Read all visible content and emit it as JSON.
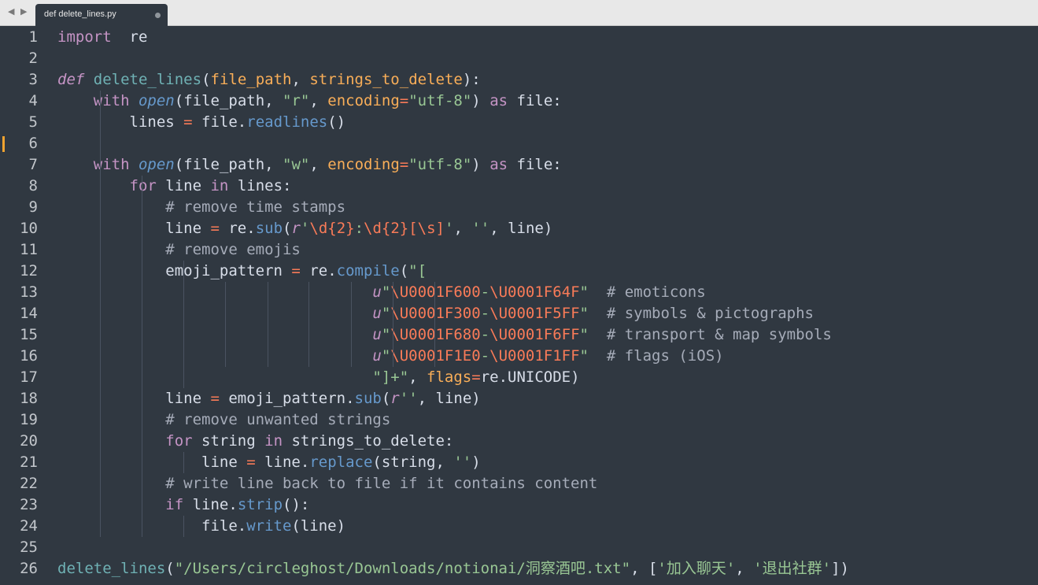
{
  "tab": {
    "title": "def delete_lines.py",
    "arrows": "◀ ▶"
  },
  "editor": {
    "lines": [
      {
        "n": "1"
      },
      {
        "n": "2"
      },
      {
        "n": "3"
      },
      {
        "n": "4"
      },
      {
        "n": "5"
      },
      {
        "n": "6"
      },
      {
        "n": "7"
      },
      {
        "n": "8"
      },
      {
        "n": "9"
      },
      {
        "n": "10"
      },
      {
        "n": "11"
      },
      {
        "n": "12"
      },
      {
        "n": "13"
      },
      {
        "n": "14"
      },
      {
        "n": "15"
      },
      {
        "n": "16"
      },
      {
        "n": "17"
      },
      {
        "n": "18"
      },
      {
        "n": "19"
      },
      {
        "n": "20"
      },
      {
        "n": "21"
      },
      {
        "n": "22"
      },
      {
        "n": "23"
      },
      {
        "n": "24"
      },
      {
        "n": "25"
      },
      {
        "n": "26"
      }
    ],
    "code": [
      [
        [
          "kw",
          "import"
        ],
        [
          "",
          "  re"
        ]
      ],
      [],
      [
        [
          "def",
          "def"
        ],
        [
          "",
          " "
        ],
        [
          "fn",
          "delete_lines"
        ],
        [
          "",
          "("
        ],
        [
          "param",
          "file_path"
        ],
        [
          "",
          ", "
        ],
        [
          "param",
          "strings_to_delete"
        ],
        [
          "",
          "):"
        ]
      ],
      [
        [
          "",
          "    "
        ],
        [
          "kw",
          "with"
        ],
        [
          "",
          " "
        ],
        [
          "bi",
          "open"
        ],
        [
          "",
          "(file_path, "
        ],
        [
          "str",
          "\"r\""
        ],
        [
          "",
          ", "
        ],
        [
          "param",
          "encoding"
        ],
        [
          "op",
          "="
        ],
        [
          "str",
          "\"utf-8\""
        ],
        [
          "",
          ") "
        ],
        [
          "kw",
          "as"
        ],
        [
          "",
          " file:"
        ]
      ],
      [
        [
          "",
          "        lines "
        ],
        [
          "op",
          "="
        ],
        [
          "",
          " file."
        ],
        [
          "meth",
          "readlines"
        ],
        [
          "",
          "()"
        ]
      ],
      [],
      [
        [
          "",
          "    "
        ],
        [
          "kw",
          "with"
        ],
        [
          "",
          " "
        ],
        [
          "bi",
          "open"
        ],
        [
          "",
          "(file_path, "
        ],
        [
          "str",
          "\"w\""
        ],
        [
          "",
          ", "
        ],
        [
          "param",
          "encoding"
        ],
        [
          "op",
          "="
        ],
        [
          "str",
          "\"utf-8\""
        ],
        [
          "",
          ") "
        ],
        [
          "kw",
          "as"
        ],
        [
          "",
          " file:"
        ]
      ],
      [
        [
          "",
          "        "
        ],
        [
          "kw",
          "for"
        ],
        [
          "",
          " line "
        ],
        [
          "kw",
          "in"
        ],
        [
          "",
          " lines:"
        ]
      ],
      [
        [
          "",
          "            "
        ],
        [
          "cm",
          "# remove time stamps"
        ]
      ],
      [
        [
          "",
          "            line "
        ],
        [
          "op",
          "="
        ],
        [
          "",
          " re."
        ],
        [
          "meth",
          "sub"
        ],
        [
          "",
          "("
        ],
        [
          "pfx",
          "r"
        ],
        [
          "str",
          "'"
        ],
        [
          "esc",
          "\\d{2}"
        ],
        [
          "str",
          ":"
        ],
        [
          "esc",
          "\\d{2}[\\s]"
        ],
        [
          "str",
          "'"
        ],
        [
          "",
          ", "
        ],
        [
          "str",
          "''"
        ],
        [
          "",
          ", line)"
        ]
      ],
      [
        [
          "",
          "            "
        ],
        [
          "cm",
          "# remove emojis"
        ]
      ],
      [
        [
          "",
          "            emoji_pattern "
        ],
        [
          "op",
          "="
        ],
        [
          "",
          " re."
        ],
        [
          "meth",
          "compile"
        ],
        [
          "",
          "("
        ],
        [
          "str",
          "\"["
        ]
      ],
      [
        [
          "",
          "                                   "
        ],
        [
          "pfx",
          "u"
        ],
        [
          "str",
          "\""
        ],
        [
          "esc",
          "\\U0001F600"
        ],
        [
          "str",
          "-"
        ],
        [
          "esc",
          "\\U0001F64F"
        ],
        [
          "str",
          "\""
        ],
        [
          "",
          "  "
        ],
        [
          "cm",
          "# emoticons"
        ]
      ],
      [
        [
          "",
          "                                   "
        ],
        [
          "pfx",
          "u"
        ],
        [
          "str",
          "\""
        ],
        [
          "esc",
          "\\U0001F300"
        ],
        [
          "str",
          "-"
        ],
        [
          "esc",
          "\\U0001F5FF"
        ],
        [
          "str",
          "\""
        ],
        [
          "",
          "  "
        ],
        [
          "cm",
          "# symbols & pictographs"
        ]
      ],
      [
        [
          "",
          "                                   "
        ],
        [
          "pfx",
          "u"
        ],
        [
          "str",
          "\""
        ],
        [
          "esc",
          "\\U0001F680"
        ],
        [
          "str",
          "-"
        ],
        [
          "esc",
          "\\U0001F6FF"
        ],
        [
          "str",
          "\""
        ],
        [
          "",
          "  "
        ],
        [
          "cm",
          "# transport & map symbols"
        ]
      ],
      [
        [
          "",
          "                                   "
        ],
        [
          "pfx",
          "u"
        ],
        [
          "str",
          "\""
        ],
        [
          "esc",
          "\\U0001F1E0"
        ],
        [
          "str",
          "-"
        ],
        [
          "esc",
          "\\U0001F1FF"
        ],
        [
          "str",
          "\""
        ],
        [
          "",
          "  "
        ],
        [
          "cm",
          "# flags (iOS)"
        ]
      ],
      [
        [
          "",
          "                                   "
        ],
        [
          "str",
          "\"]+\""
        ],
        [
          "",
          ", "
        ],
        [
          "param",
          "flags"
        ],
        [
          "op",
          "="
        ],
        [
          "",
          "re.UNICODE)"
        ]
      ],
      [
        [
          "",
          "            line "
        ],
        [
          "op",
          "="
        ],
        [
          "",
          " emoji_pattern."
        ],
        [
          "meth",
          "sub"
        ],
        [
          "",
          "("
        ],
        [
          "pfx",
          "r"
        ],
        [
          "str",
          "''"
        ],
        [
          "",
          ", line)"
        ]
      ],
      [
        [
          "",
          "            "
        ],
        [
          "cm",
          "# remove unwanted strings"
        ]
      ],
      [
        [
          "",
          "            "
        ],
        [
          "kw",
          "for"
        ],
        [
          "",
          " string "
        ],
        [
          "kw",
          "in"
        ],
        [
          "",
          " strings_to_delete:"
        ]
      ],
      [
        [
          "",
          "                line "
        ],
        [
          "op",
          "="
        ],
        [
          "",
          " line."
        ],
        [
          "meth",
          "replace"
        ],
        [
          "",
          "(string, "
        ],
        [
          "str",
          "''"
        ],
        [
          "",
          ")"
        ]
      ],
      [
        [
          "",
          "            "
        ],
        [
          "cm",
          "# write line back to file if it contains content"
        ]
      ],
      [
        [
          "",
          "            "
        ],
        [
          "kw",
          "if"
        ],
        [
          "",
          " line."
        ],
        [
          "meth",
          "strip"
        ],
        [
          "",
          "():"
        ]
      ],
      [
        [
          "",
          "                file."
        ],
        [
          "meth",
          "write"
        ],
        [
          "",
          "(line)"
        ]
      ],
      [],
      [
        [
          "fn",
          "delete_lines"
        ],
        [
          "",
          "("
        ],
        [
          "str",
          "\"/Users/circleghost/Downloads/notionai/洞察酒吧.txt\""
        ],
        [
          "",
          ", ["
        ],
        [
          "str",
          "'加入聊天'"
        ],
        [
          "",
          ", "
        ],
        [
          "str",
          "'退出社群'"
        ],
        [
          "",
          "])"
        ]
      ]
    ],
    "modified_line": "6"
  },
  "colors": {
    "background": "#303841",
    "keyword": "#c594c5",
    "function": "#6fb1b4",
    "parameter": "#f9ae58",
    "string": "#99c794",
    "comment": "#a6acb9",
    "operator": "#f97b58",
    "builtin": "#6699cc"
  }
}
